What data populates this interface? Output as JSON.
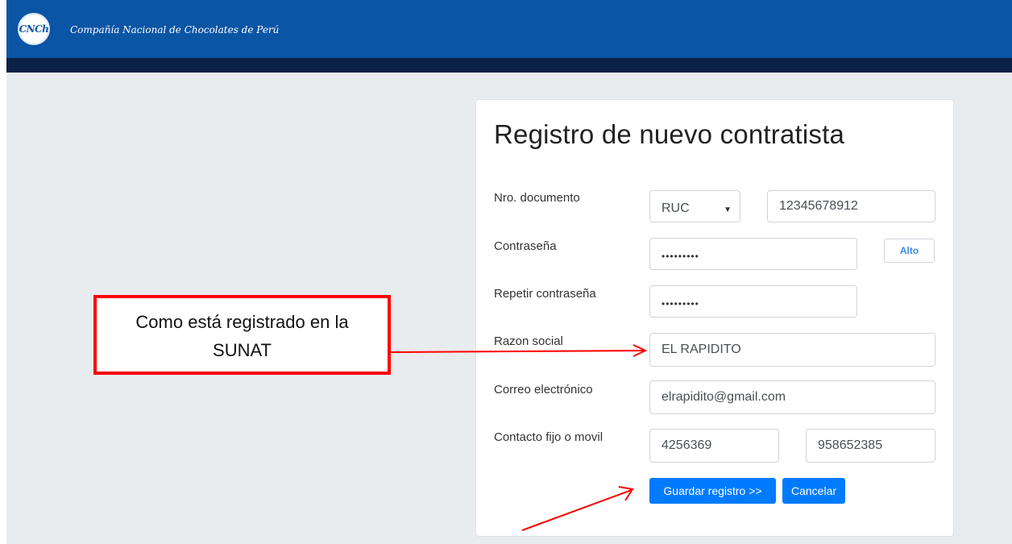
{
  "header": {
    "logo_text": "CNCh",
    "brand": "Compañía Nacional de Chocolates de Perú"
  },
  "form": {
    "title": "Registro de nuevo contratista",
    "doc_label": "Nro. documento",
    "doc_type": "RUC",
    "doc_number": "12345678912",
    "password_label": "Contraseña",
    "password_value": "•••••••••",
    "strength": "Alto",
    "repeat_label": "Repetir contraseña",
    "repeat_value": "•••••••••",
    "razon_label": "Razon social",
    "razon_value": "EL RAPIDITO",
    "email_label": "Correo electrónico",
    "email_value": "elrapidito@gmail.com",
    "contact_label": "Contacto fijo o movil",
    "phone_fixed": "4256369",
    "phone_mobile": "958652385",
    "save_label": "Guardar registro >>",
    "cancel_label": "Cancelar"
  },
  "annotation": {
    "callout_line1": "Como está registrado en la",
    "callout_line2": "SUNAT",
    "color": "#ff0000"
  },
  "colors": {
    "header": "#0b55a5",
    "header_strip": "#0b2147",
    "primary": "#007bff"
  }
}
